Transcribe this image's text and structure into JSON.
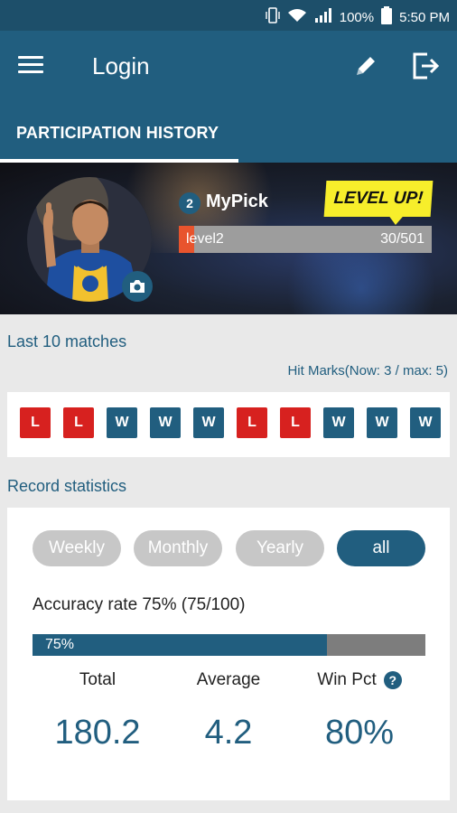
{
  "status": {
    "battery": "100%",
    "time": "5:50 PM"
  },
  "appbar": {
    "title": "Login"
  },
  "tabs": [
    {
      "label": "PARTICIPATION HISTORY"
    }
  ],
  "profile": {
    "rank": "2",
    "username": "MyPick",
    "levelup_label": "LEVEL UP!",
    "level_label": "level2",
    "points": "30/501",
    "points_current": 30,
    "points_max": 501
  },
  "matches": {
    "title": "Last 10 matches",
    "hit_marks": "Hit Marks(Now: 3 / max: 5)",
    "results": [
      "L",
      "L",
      "W",
      "W",
      "W",
      "L",
      "L",
      "W",
      "W",
      "W"
    ]
  },
  "record": {
    "title": "Record statistics",
    "periods": [
      "Weekly",
      "Monthly",
      "Yearly",
      "all"
    ],
    "active_period": "all",
    "accuracy_text": "Accuracy rate 75% (75/100)",
    "accuracy_bar_label": "75%",
    "accuracy_fraction": 0.75,
    "total_label": "Total",
    "total_value": "180.2",
    "average_label": "Average",
    "average_value": "4.2",
    "winpct_label": "Win Pct",
    "winpct_value": "80%",
    "help_glyph": "?"
  },
  "icons": {
    "menu": "hamburger-icon",
    "edit": "pencil-icon",
    "logout": "logout-icon",
    "camera": "camera-icon"
  }
}
